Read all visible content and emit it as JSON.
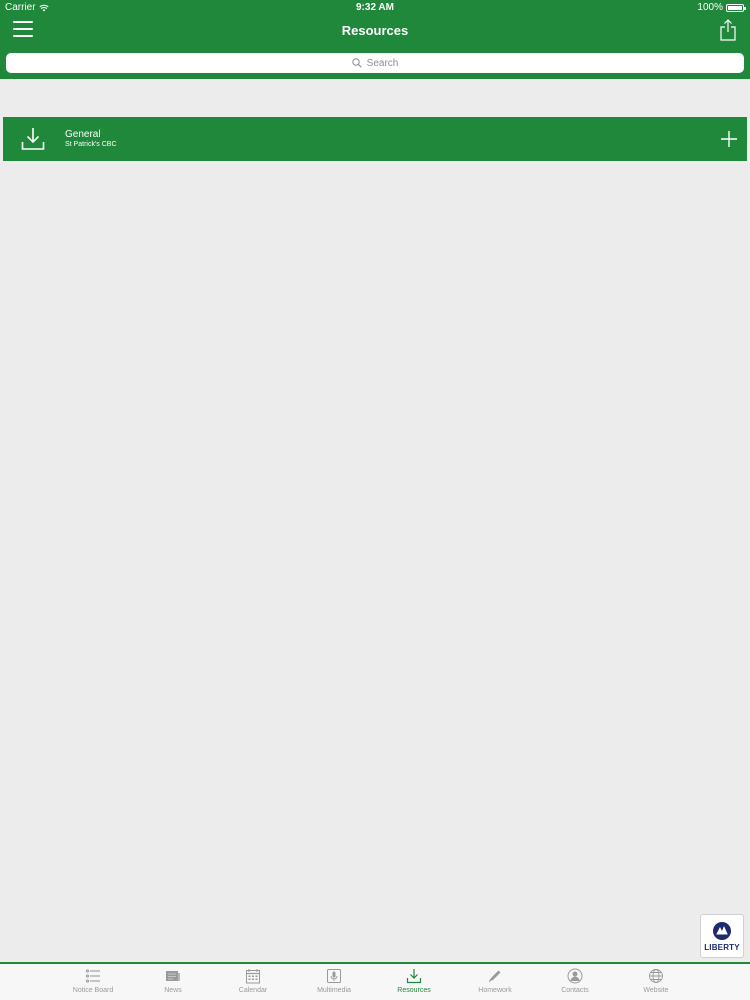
{
  "status": {
    "carrier": "Carrier",
    "time": "9:32 AM",
    "battery": "100%"
  },
  "header": {
    "title": "Resources"
  },
  "search": {
    "placeholder": "Search"
  },
  "resources": [
    {
      "title": "General",
      "subtitle": "St Patrick's CBC"
    }
  ],
  "sponsor": {
    "label": "LIBERTY"
  },
  "tabs": [
    {
      "label": "Notice Board",
      "icon": "list-icon"
    },
    {
      "label": "News",
      "icon": "newspaper-icon"
    },
    {
      "label": "Calendar",
      "icon": "calendar-icon"
    },
    {
      "label": "Multimedia",
      "icon": "microphone-icon"
    },
    {
      "label": "Resources",
      "icon": "download-icon",
      "active": true
    },
    {
      "label": "Homework",
      "icon": "pencil-icon"
    },
    {
      "label": "Contacts",
      "icon": "person-icon"
    },
    {
      "label": "Website",
      "icon": "globe-icon"
    }
  ],
  "colors": {
    "brand": "#1f883a",
    "background": "#ececec",
    "tab_inactive": "#9a9a9a"
  }
}
